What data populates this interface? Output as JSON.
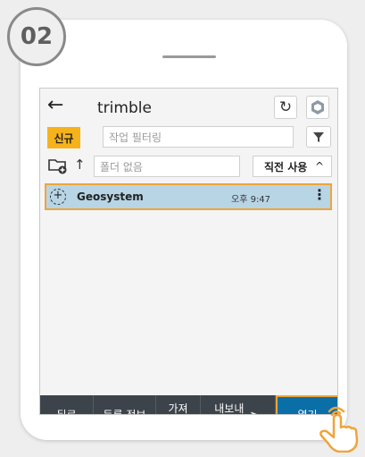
{
  "step": "02",
  "header": {
    "title": "trimble",
    "back_icon": "arrow-left-icon",
    "refresh_icon": "refresh-icon",
    "cloud_icon": "trimble-connect-icon"
  },
  "toolbar": {
    "new_label": "신규",
    "filter_placeholder": "작업 필터링",
    "filter_icon": "filter-icon"
  },
  "folder_row": {
    "folder_placeholder": "폴더 없음",
    "sort_label": "직전 사용",
    "chevron": "^"
  },
  "jobs": [
    {
      "name": "Geosystem",
      "time": "오후 9:47"
    }
  ],
  "bottom_bar": {
    "back_label": "뒤로",
    "properties_label": "등록 정보",
    "import_label": "가져오 기",
    "export_label": "내보내 기",
    "export_arrow": ">",
    "open_label": "열기"
  }
}
